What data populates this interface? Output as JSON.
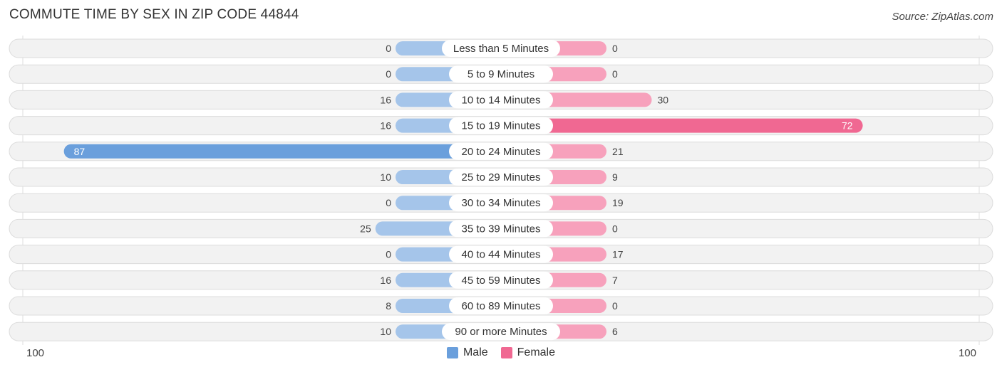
{
  "header": {
    "title": "COMMUTE TIME BY SEX IN ZIP CODE 44844",
    "source": "Source: ZipAtlas.com"
  },
  "colors": {
    "male": "#6a9fdc",
    "male_light": "#a5c5ea",
    "female": "#f06892",
    "female_light": "#f7a1bc",
    "row_bg": "#f2f2f2",
    "label_bg": "#ffffff"
  },
  "chart_data": {
    "type": "bar",
    "orientation": "horizontal-diverging",
    "title": "COMMUTE TIME BY SEX IN ZIP CODE 44844",
    "categories": [
      "Less than 5 Minutes",
      "5 to 9 Minutes",
      "10 to 14 Minutes",
      "15 to 19 Minutes",
      "20 to 24 Minutes",
      "25 to 29 Minutes",
      "30 to 34 Minutes",
      "35 to 39 Minutes",
      "40 to 44 Minutes",
      "45 to 59 Minutes",
      "60 to 89 Minutes",
      "90 or more Minutes"
    ],
    "series": [
      {
        "name": "Male",
        "values": [
          0,
          0,
          16,
          16,
          87,
          10,
          0,
          25,
          0,
          16,
          8,
          10
        ]
      },
      {
        "name": "Female",
        "values": [
          0,
          0,
          30,
          72,
          21,
          9,
          19,
          0,
          17,
          7,
          0,
          6
        ]
      }
    ],
    "axis": {
      "left_label": "100",
      "right_label": "100",
      "range": [
        100,
        100
      ]
    },
    "legend": {
      "position": "bottom-center",
      "entries": [
        "Male",
        "Female"
      ]
    },
    "grid": false
  }
}
